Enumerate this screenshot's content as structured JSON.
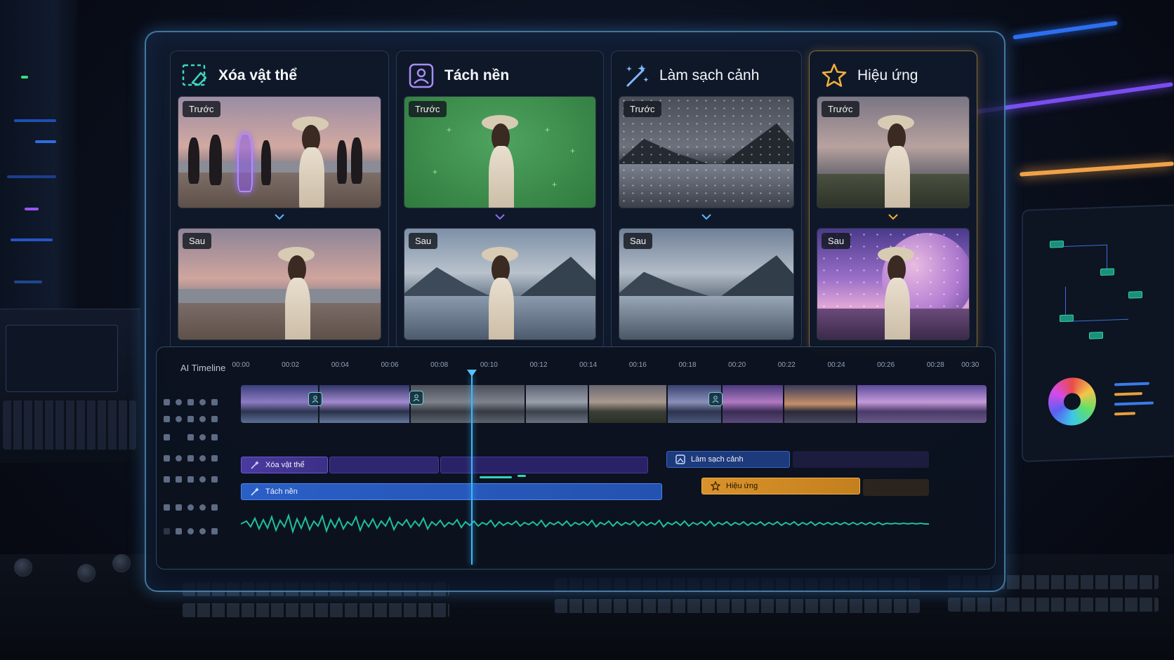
{
  "cards": [
    {
      "title": "Xóa vật thể",
      "before_label": "Trước",
      "after_label": "Sau",
      "icon": "object-erase-icon"
    },
    {
      "title": "Tách nền",
      "before_label": "Trước",
      "after_label": "Sau",
      "icon": "person-portrait-icon"
    },
    {
      "title": "Làm sạch cảnh",
      "before_label": "Trước",
      "after_label": "Sau",
      "icon": "magic-wand-icon"
    },
    {
      "title": "Hiệu ứng",
      "before_label": "Trước",
      "after_label": "Sau",
      "icon": "star-icon"
    }
  ],
  "timeline": {
    "title": "AI Timeline",
    "ticks": [
      "00:00",
      "00:02",
      "00:04",
      "00:06",
      "00:08",
      "00:10",
      "00:12",
      "00:14",
      "00:16",
      "00:18",
      "00:20",
      "00:22",
      "00:24",
      "00:26",
      "00:28",
      "00:30"
    ],
    "playhead_time_seconds": 9.3,
    "clips": {
      "xoa_vat_the": "Xóa vật thể",
      "tach_nen": "Tách nền",
      "lam_sach_canh": "Làm sạch cảnh",
      "hieu_ung": "Hiệu ứng"
    }
  },
  "colors": {
    "accent_blue": "#3fb6ff",
    "clip_purple": "#4a3aa0",
    "clip_blue": "#2a5fc6",
    "clip_orange": "#d9922b",
    "waveform": "#1fbf9c",
    "active_card_border": "#f0b446"
  }
}
